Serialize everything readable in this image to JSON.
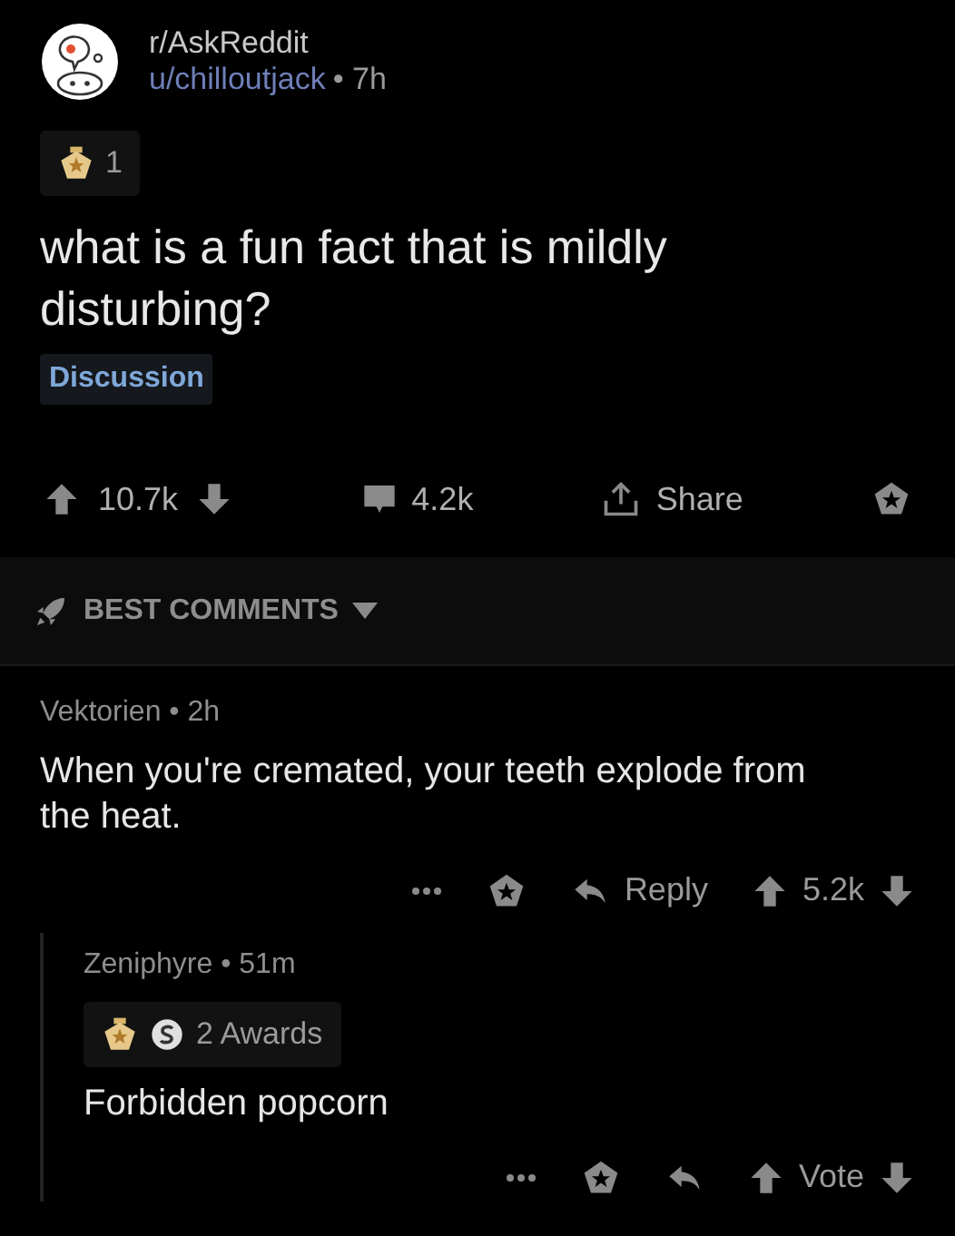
{
  "post": {
    "subreddit": "r/AskReddit",
    "author": "u/chilloutjack",
    "age": "• 7h",
    "awards": [
      {
        "kind": "gold"
      }
    ],
    "award_label": "1",
    "title": "what is a fun fact that is mildly disturbing?",
    "flair": "Discussion",
    "score": "10.7k",
    "comment_count": "4.2k",
    "share_label": "Share"
  },
  "sort": {
    "label": "BEST COMMENTS"
  },
  "comments": [
    {
      "meta": "Vektorien • 2h",
      "body": "When you're cremated, your teeth explode from the heat.",
      "reply_label": "Reply",
      "score": "5.2k",
      "children": [
        {
          "meta": "Zeniphyre • 51m",
          "awards": [
            {
              "kind": "gold"
            },
            {
              "kind": "silver"
            }
          ],
          "award_label": "2 Awards",
          "body": "Forbidden popcorn",
          "score": "Vote"
        }
      ]
    }
  ]
}
